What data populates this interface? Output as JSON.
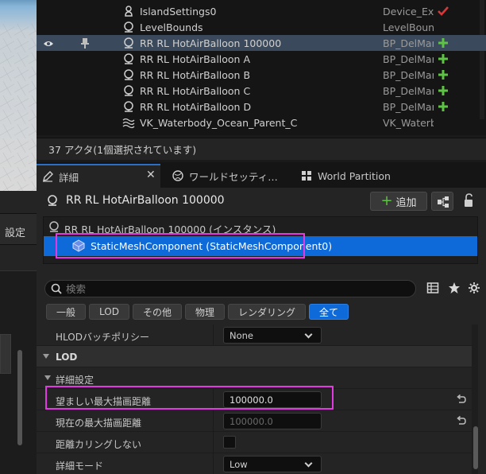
{
  "outliner": {
    "rows": [
      {
        "label": "IslandSettings0",
        "type": "Device_Exp",
        "icon": "settings-actor-icon",
        "action": "checkmark-icon",
        "selected": false
      },
      {
        "label": "LevelBounds",
        "type": "LevelBounds",
        "icon": "actor-icon",
        "action": "",
        "selected": false
      },
      {
        "label": "RR RL HotAirBalloon 100000",
        "type": "BP_DelMar",
        "icon": "actor-icon",
        "action": "add-icon",
        "selected": true
      },
      {
        "label": "RR RL HotAirBalloon A",
        "type": "BP_DelMar",
        "icon": "actor-icon",
        "action": "add-icon",
        "selected": false
      },
      {
        "label": "RR RL HotAirBalloon B",
        "type": "BP_DelMar",
        "icon": "actor-icon",
        "action": "add-icon",
        "selected": false
      },
      {
        "label": "RR RL HotAirBalloon C",
        "type": "BP_DelMar",
        "icon": "actor-icon",
        "action": "add-icon",
        "selected": false
      },
      {
        "label": "RR RL HotAirBalloon D",
        "type": "BP_DelMar",
        "icon": "actor-icon",
        "action": "add-icon",
        "selected": false
      },
      {
        "label": "VK_Waterbody_Ocean_Parent_C",
        "type": "VK_Waterb",
        "icon": "water-icon",
        "action": "",
        "selected": false
      }
    ],
    "status": "37 アクタ(1個選択されています)"
  },
  "left": {
    "panel_label": "設定"
  },
  "tabs": [
    {
      "label": "詳細",
      "icon": "details-icon",
      "active": true
    },
    {
      "label": "ワールドセッティ…",
      "icon": "globe-icon",
      "active": false
    },
    {
      "label": "World Partition",
      "icon": "grid-icon",
      "active": false
    }
  ],
  "details": {
    "actor_name": "RR RL HotAirBalloon 100000",
    "add_label": "追加",
    "component_root": "RR RL HotAirBalloon 100000 (インスタンス)",
    "component_selected": "StaticMeshComponent (StaticMeshComponent0)",
    "search_placeholder": "検索",
    "filters": [
      "一般",
      "LOD",
      "その他",
      "物理",
      "レンダリング",
      "全て"
    ],
    "active_filter": "全て",
    "properties": {
      "hlod_label": "HLODバッチポリシー",
      "hlod_value": "None",
      "lod_category": "LOD",
      "advanced_label": "詳細設定",
      "max_draw_label": "望ましい最大描画距離",
      "max_draw_value": "100000.0",
      "current_draw_label": "現在の最大描画距離",
      "current_draw_value": "100000.0",
      "no_distance_cull_label": "距離カリングしない",
      "detail_mode_label": "詳細モード",
      "detail_mode_value": "Low"
    }
  },
  "colors": {
    "selection_blue": "#0e6ad8",
    "highlight_magenta": "#e23ae0",
    "add_green": "#5ec245",
    "check_red": "#d9383a"
  }
}
